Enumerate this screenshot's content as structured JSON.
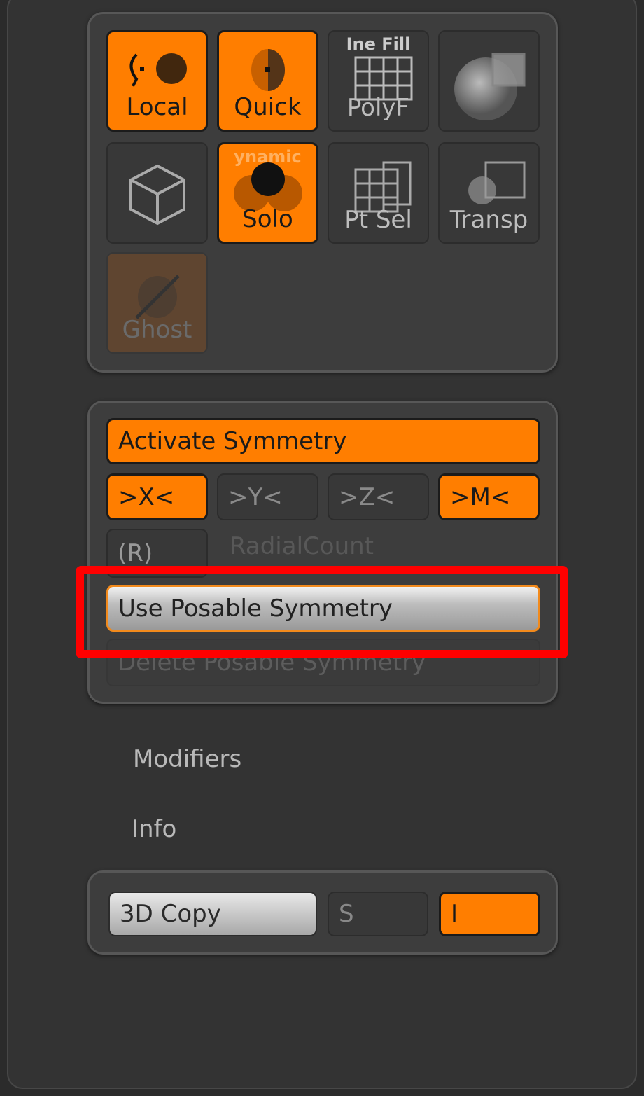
{
  "grid_buttons": [
    {
      "label": "Local",
      "active": true,
      "icon": "local-symmetry-icon"
    },
    {
      "label": "Quick",
      "active": true,
      "icon": "quick-icon"
    },
    {
      "label": "PolyF",
      "active": false,
      "icon": "polyframe-grid-icon",
      "overlay": "Ine Fill"
    },
    {
      "label": "",
      "active": false,
      "icon": "sphere-grid-icon"
    },
    {
      "label": "",
      "active": false,
      "icon": "cube-icon"
    },
    {
      "label": "Solo",
      "active": true,
      "icon": "solo-icon",
      "overlay": "ynamic"
    },
    {
      "label": "Pt Sel",
      "active": false,
      "icon": "point-select-icon"
    },
    {
      "label": "Transp",
      "active": false,
      "icon": "transparency-icon"
    },
    {
      "label": "Ghost",
      "active": false,
      "icon": "ghost-icon",
      "disabled": true
    }
  ],
  "symmetry": {
    "activate": "Activate Symmetry",
    "axes": [
      {
        "label": ">X<",
        "active": true
      },
      {
        "label": ">Y<",
        "active": false
      },
      {
        "label": ">Z<",
        "active": false
      },
      {
        "label": ">M<",
        "active": true
      }
    ],
    "radial": "(R)",
    "radial_count": "RadialCount",
    "use_posable": "Use Posable Symmetry",
    "delete_posable": "Delete Posable Symmetry"
  },
  "sections": {
    "modifiers": "Modifiers",
    "info": "Info"
  },
  "copy_row": {
    "copy": "3D Copy",
    "s": "S",
    "i": "I"
  },
  "colors": {
    "accent": "#ff7e00",
    "highlight": "#ff0000"
  }
}
